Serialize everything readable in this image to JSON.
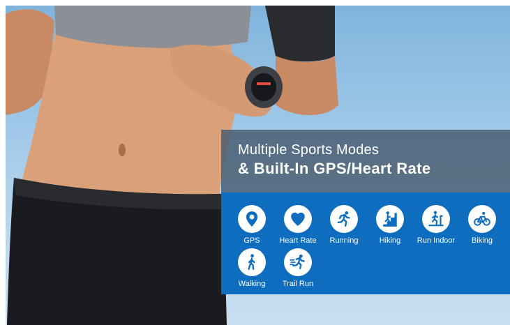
{
  "banner": {
    "title_line1": "Multiple Sports Modes",
    "title_line2": "& Built-In GPS/Heart Rate"
  },
  "modes": [
    {
      "label": "GPS",
      "icon": "location-pin-icon"
    },
    {
      "label": "Heart Rate",
      "icon": "heart-icon"
    },
    {
      "label": "Running",
      "icon": "running-icon"
    },
    {
      "label": "Hiking",
      "icon": "hiking-icon"
    },
    {
      "label": "Run Indoor",
      "icon": "treadmill-icon"
    },
    {
      "label": "Biking",
      "icon": "bicycle-icon"
    },
    {
      "label": "Walking",
      "icon": "walking-icon"
    },
    {
      "label": "Trail Run",
      "icon": "trail-run-icon"
    }
  ],
  "colors": {
    "modes_panel": "#0e6dbf",
    "title_panel": "#465a6e",
    "sky": "#9cc6e6",
    "icon_blue": "#0e6dbf"
  }
}
